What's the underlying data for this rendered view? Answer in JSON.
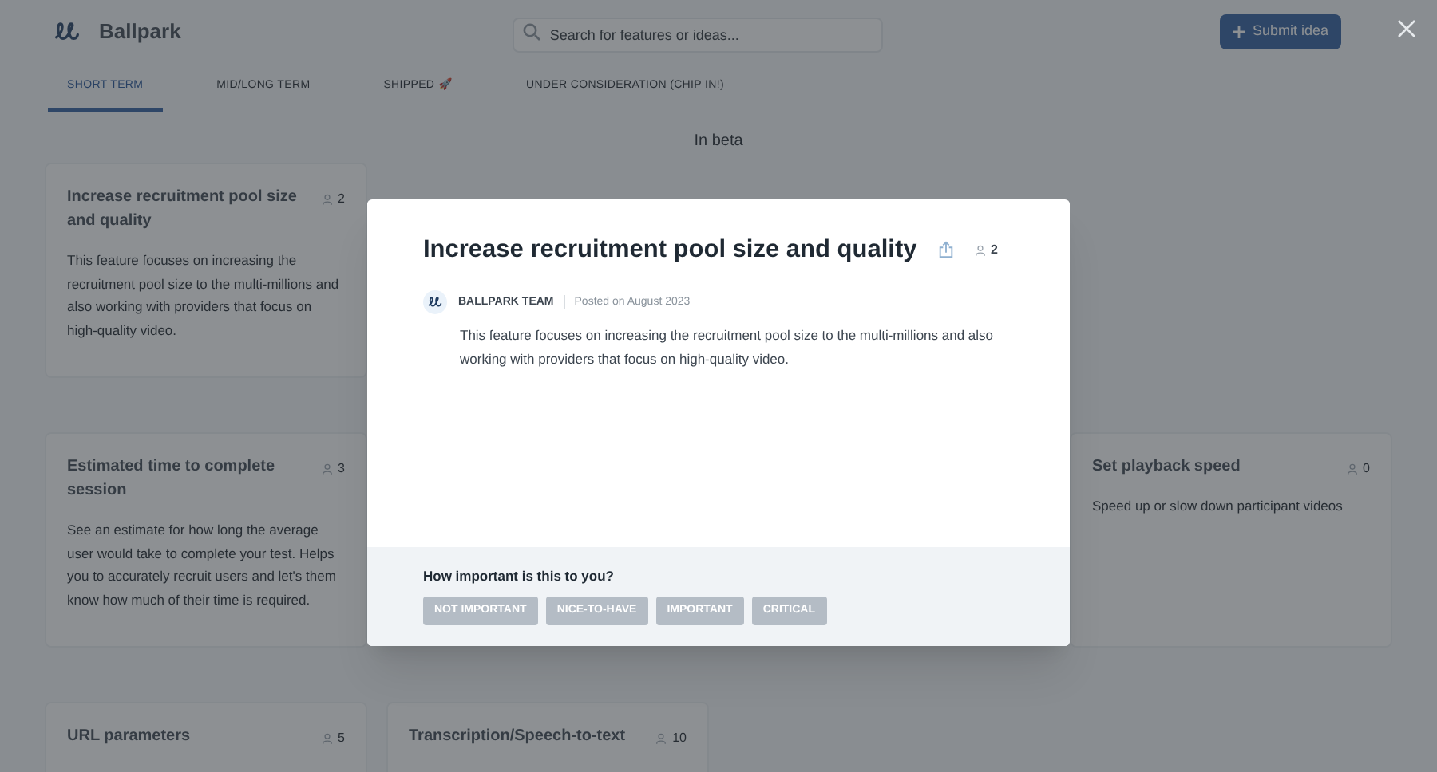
{
  "header": {
    "brand": "Ballpark",
    "search": {
      "placeholder": "Search for features or ideas..."
    },
    "submit_button": "Submit idea"
  },
  "tabs": [
    {
      "label": "SHORT TERM",
      "selected": true
    },
    {
      "label": "MID/LONG TERM",
      "selected": false
    },
    {
      "label": "SHIPPED 🚀",
      "selected": false
    },
    {
      "label": "UNDER CONSIDERATION (CHIP IN!)",
      "selected": false
    }
  ],
  "section_title": "In beta",
  "cards": [
    {
      "title": "Increase recruitment pool size and quality",
      "votes": "2",
      "description": "This feature focuses on increasing the recruitment pool size to the multi-millions and also working with providers that focus on high-quality video."
    },
    {
      "title": "Estimated time to complete session",
      "votes": "3",
      "description": "See an estimate for how long the average user would take to complete your test. Helps you to accurately recruit users and let's them know how much of their time is required."
    },
    {
      "title": "Set playback speed",
      "votes": "0",
      "description": "Speed up or slow down participant videos"
    },
    {
      "title": "URL parameters",
      "votes": "5"
    },
    {
      "title": "Transcription/Speech-to-text",
      "votes": "10"
    }
  ],
  "modal": {
    "title": "Increase recruitment pool size and quality",
    "votes": "2",
    "author": "BALLPARK TEAM",
    "posted": "Posted on August 2023",
    "body": "This feature focuses on increasing the recruitment pool size to the multi-millions and also working with providers that focus on high-quality video.",
    "question": "How important is this to you?",
    "options": [
      {
        "label": "NOT IMPORTANT",
        "selected": false
      },
      {
        "label": "NICE-TO-HAVE",
        "selected": false
      },
      {
        "label": "IMPORTANT",
        "selected": false
      },
      {
        "label": "CRITICAL",
        "selected": false
      }
    ]
  }
}
